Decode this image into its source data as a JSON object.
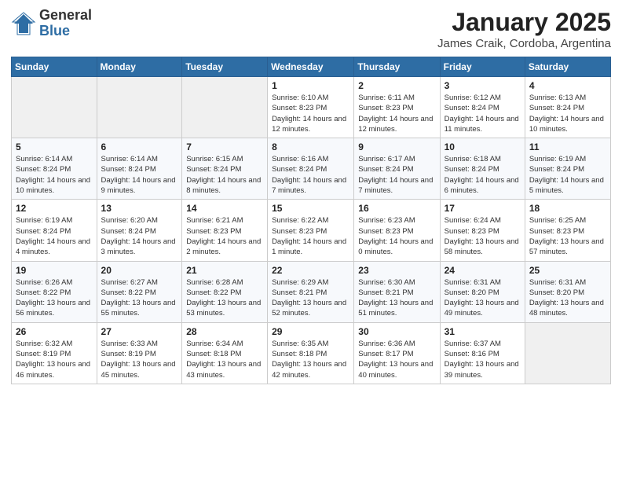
{
  "header": {
    "logo_general": "General",
    "logo_blue": "Blue",
    "title": "January 2025",
    "subtitle": "James Craik, Cordoba, Argentina"
  },
  "days_of_week": [
    "Sunday",
    "Monday",
    "Tuesday",
    "Wednesday",
    "Thursday",
    "Friday",
    "Saturday"
  ],
  "weeks": [
    [
      {
        "day": "",
        "info": ""
      },
      {
        "day": "",
        "info": ""
      },
      {
        "day": "",
        "info": ""
      },
      {
        "day": "1",
        "info": "Sunrise: 6:10 AM\nSunset: 8:23 PM\nDaylight: 14 hours and 12 minutes."
      },
      {
        "day": "2",
        "info": "Sunrise: 6:11 AM\nSunset: 8:23 PM\nDaylight: 14 hours and 12 minutes."
      },
      {
        "day": "3",
        "info": "Sunrise: 6:12 AM\nSunset: 8:24 PM\nDaylight: 14 hours and 11 minutes."
      },
      {
        "day": "4",
        "info": "Sunrise: 6:13 AM\nSunset: 8:24 PM\nDaylight: 14 hours and 10 minutes."
      }
    ],
    [
      {
        "day": "5",
        "info": "Sunrise: 6:14 AM\nSunset: 8:24 PM\nDaylight: 14 hours and 10 minutes."
      },
      {
        "day": "6",
        "info": "Sunrise: 6:14 AM\nSunset: 8:24 PM\nDaylight: 14 hours and 9 minutes."
      },
      {
        "day": "7",
        "info": "Sunrise: 6:15 AM\nSunset: 8:24 PM\nDaylight: 14 hours and 8 minutes."
      },
      {
        "day": "8",
        "info": "Sunrise: 6:16 AM\nSunset: 8:24 PM\nDaylight: 14 hours and 7 minutes."
      },
      {
        "day": "9",
        "info": "Sunrise: 6:17 AM\nSunset: 8:24 PM\nDaylight: 14 hours and 7 minutes."
      },
      {
        "day": "10",
        "info": "Sunrise: 6:18 AM\nSunset: 8:24 PM\nDaylight: 14 hours and 6 minutes."
      },
      {
        "day": "11",
        "info": "Sunrise: 6:19 AM\nSunset: 8:24 PM\nDaylight: 14 hours and 5 minutes."
      }
    ],
    [
      {
        "day": "12",
        "info": "Sunrise: 6:19 AM\nSunset: 8:24 PM\nDaylight: 14 hours and 4 minutes."
      },
      {
        "day": "13",
        "info": "Sunrise: 6:20 AM\nSunset: 8:24 PM\nDaylight: 14 hours and 3 minutes."
      },
      {
        "day": "14",
        "info": "Sunrise: 6:21 AM\nSunset: 8:23 PM\nDaylight: 14 hours and 2 minutes."
      },
      {
        "day": "15",
        "info": "Sunrise: 6:22 AM\nSunset: 8:23 PM\nDaylight: 14 hours and 1 minute."
      },
      {
        "day": "16",
        "info": "Sunrise: 6:23 AM\nSunset: 8:23 PM\nDaylight: 14 hours and 0 minutes."
      },
      {
        "day": "17",
        "info": "Sunrise: 6:24 AM\nSunset: 8:23 PM\nDaylight: 13 hours and 58 minutes."
      },
      {
        "day": "18",
        "info": "Sunrise: 6:25 AM\nSunset: 8:23 PM\nDaylight: 13 hours and 57 minutes."
      }
    ],
    [
      {
        "day": "19",
        "info": "Sunrise: 6:26 AM\nSunset: 8:22 PM\nDaylight: 13 hours and 56 minutes."
      },
      {
        "day": "20",
        "info": "Sunrise: 6:27 AM\nSunset: 8:22 PM\nDaylight: 13 hours and 55 minutes."
      },
      {
        "day": "21",
        "info": "Sunrise: 6:28 AM\nSunset: 8:22 PM\nDaylight: 13 hours and 53 minutes."
      },
      {
        "day": "22",
        "info": "Sunrise: 6:29 AM\nSunset: 8:21 PM\nDaylight: 13 hours and 52 minutes."
      },
      {
        "day": "23",
        "info": "Sunrise: 6:30 AM\nSunset: 8:21 PM\nDaylight: 13 hours and 51 minutes."
      },
      {
        "day": "24",
        "info": "Sunrise: 6:31 AM\nSunset: 8:20 PM\nDaylight: 13 hours and 49 minutes."
      },
      {
        "day": "25",
        "info": "Sunrise: 6:31 AM\nSunset: 8:20 PM\nDaylight: 13 hours and 48 minutes."
      }
    ],
    [
      {
        "day": "26",
        "info": "Sunrise: 6:32 AM\nSunset: 8:19 PM\nDaylight: 13 hours and 46 minutes."
      },
      {
        "day": "27",
        "info": "Sunrise: 6:33 AM\nSunset: 8:19 PM\nDaylight: 13 hours and 45 minutes."
      },
      {
        "day": "28",
        "info": "Sunrise: 6:34 AM\nSunset: 8:18 PM\nDaylight: 13 hours and 43 minutes."
      },
      {
        "day": "29",
        "info": "Sunrise: 6:35 AM\nSunset: 8:18 PM\nDaylight: 13 hours and 42 minutes."
      },
      {
        "day": "30",
        "info": "Sunrise: 6:36 AM\nSunset: 8:17 PM\nDaylight: 13 hours and 40 minutes."
      },
      {
        "day": "31",
        "info": "Sunrise: 6:37 AM\nSunset: 8:16 PM\nDaylight: 13 hours and 39 minutes."
      },
      {
        "day": "",
        "info": ""
      }
    ]
  ]
}
